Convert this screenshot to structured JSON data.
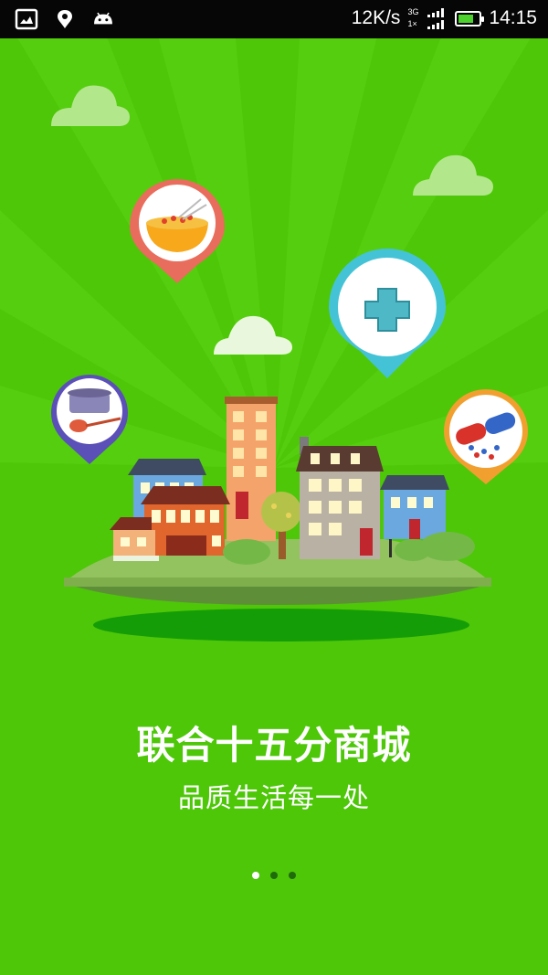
{
  "status_bar": {
    "speed": "12K/s",
    "network_top": "3G",
    "network_bottom": "1×",
    "time": "14:15",
    "battery_level": 0.75,
    "left_icons": [
      "image-icon",
      "notification-icon",
      "android-icon"
    ]
  },
  "splash": {
    "title": "联合十五分商城",
    "subtitle": "品质生活每一处"
  },
  "pager": {
    "count": 3,
    "active_index": 0
  },
  "colors": {
    "background": "#4dc708",
    "status_bar": "#060606",
    "island_top": "#8fc35a",
    "shadow": "#159d07",
    "pin_food": "#e86d5c",
    "pin_medical": "#45c3d6",
    "pin_pot": "#5b4fb8",
    "pin_medicine": "#f1a02f"
  }
}
